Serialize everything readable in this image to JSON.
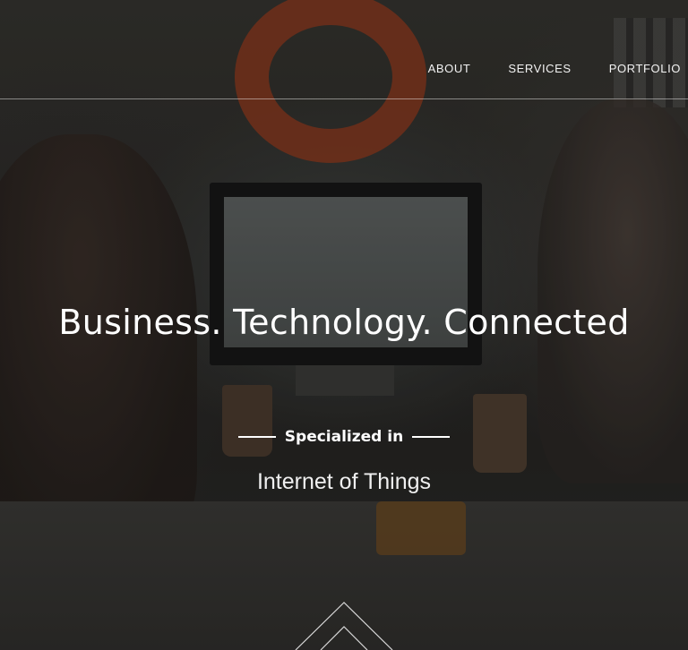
{
  "nav": {
    "items": [
      {
        "label": "ABOUT"
      },
      {
        "label": "SERVICES"
      },
      {
        "label": "PORTFOLIO"
      }
    ]
  },
  "hero": {
    "title": "Business. Technology. Connected",
    "specialized_label": "Specialized in",
    "rotating_text": "Internet of Things"
  },
  "scroll": {
    "icon": "chevron-up-lines-icon"
  },
  "colors": {
    "text": "#ffffff",
    "nav_divider": "#ffffff",
    "overlay": "#1d1d1b"
  }
}
